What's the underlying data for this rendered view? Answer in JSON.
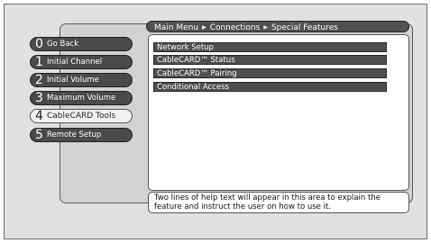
{
  "breadcrumb": [
    "Main Menu",
    "Connections",
    "Special Features"
  ],
  "sidebar": {
    "items": [
      {
        "num": "0",
        "label": "Go Back"
      },
      {
        "num": "1",
        "label": "Initial Channel"
      },
      {
        "num": "2",
        "label": "Initial Volume"
      },
      {
        "num": "3",
        "label": "Maximum Volume"
      },
      {
        "num": "4",
        "label": "CableCARD Tools"
      },
      {
        "num": "5",
        "label": "Remote Setup"
      }
    ],
    "selected_index": 4
  },
  "content": {
    "items": [
      "Network Setup",
      "CableCARD™ Status",
      "CableCARD™ Pairing",
      "Conditional Access"
    ]
  },
  "help_text": "Two lines of help text will appear in this area to explain the feature and instruct the user on how to use it.",
  "colors": {
    "button_dark": "#4a4a4a",
    "button_selected": "#f2f2f2",
    "panel_background": "#d2d2d2",
    "content_background": "#ffffff"
  }
}
